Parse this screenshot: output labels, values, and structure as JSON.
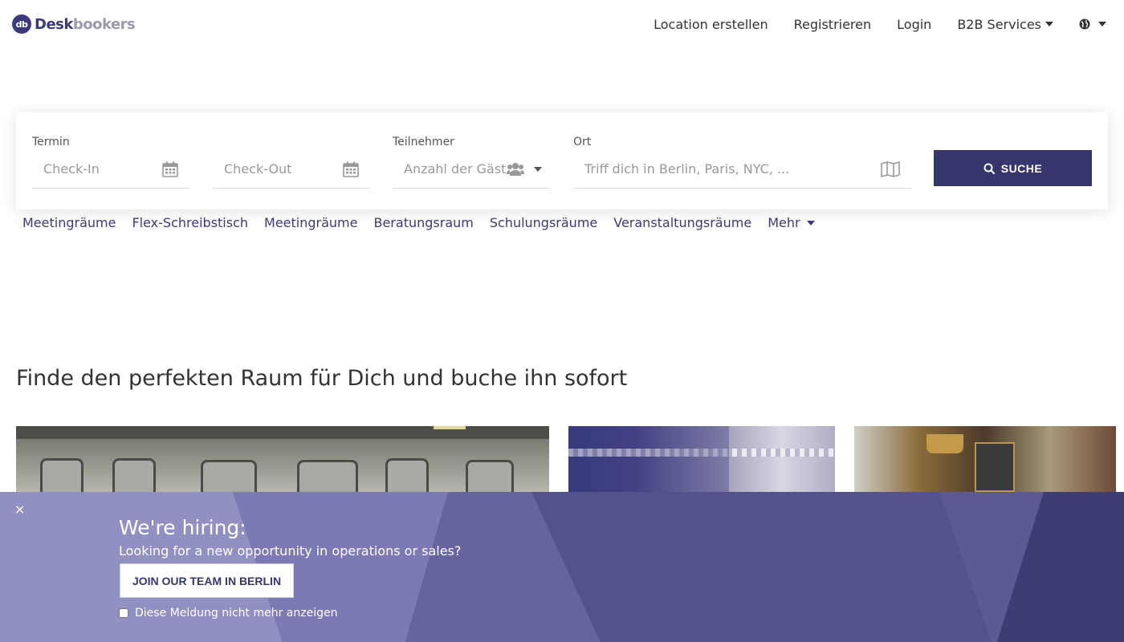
{
  "brand": {
    "badge": "db",
    "name_part1": "Desk",
    "name_part2": "bookers"
  },
  "nav": {
    "create_location": "Location erstellen",
    "register": "Registrieren",
    "login": "Login",
    "b2b": "B2B Services"
  },
  "search": {
    "termin_label": "Termin",
    "checkin_placeholder": "Check-In",
    "checkout_placeholder": "Check-Out",
    "participants_label": "Teilnehmer",
    "guests_placeholder": "Anzahl der Gäste",
    "location_label": "Ort",
    "location_placeholder": "Triff dich in Berlin, Paris, NYC, ...",
    "button": "SUCHE"
  },
  "categories": [
    "Meetingräume",
    "Flex-Schreibstisch",
    "Meetingräume",
    "Beratungsraum",
    "Schulungsräume",
    "Veranstaltungsräume"
  ],
  "categories_more": "Mehr",
  "headline": "Finde den perfekten Raum für Dich und buche ihn sofort",
  "banner": {
    "close": "×",
    "title": "We're hiring:",
    "subtitle": "Looking for a new opportunity in operations or sales?",
    "button": "JOIN OUR TEAM IN BERLIN",
    "checkbox_label": "Diese Meldung nicht mehr anzeigen"
  },
  "colors": {
    "brand": "#36366e",
    "link": "#3a3a7a",
    "banner": "#4c4a84"
  }
}
